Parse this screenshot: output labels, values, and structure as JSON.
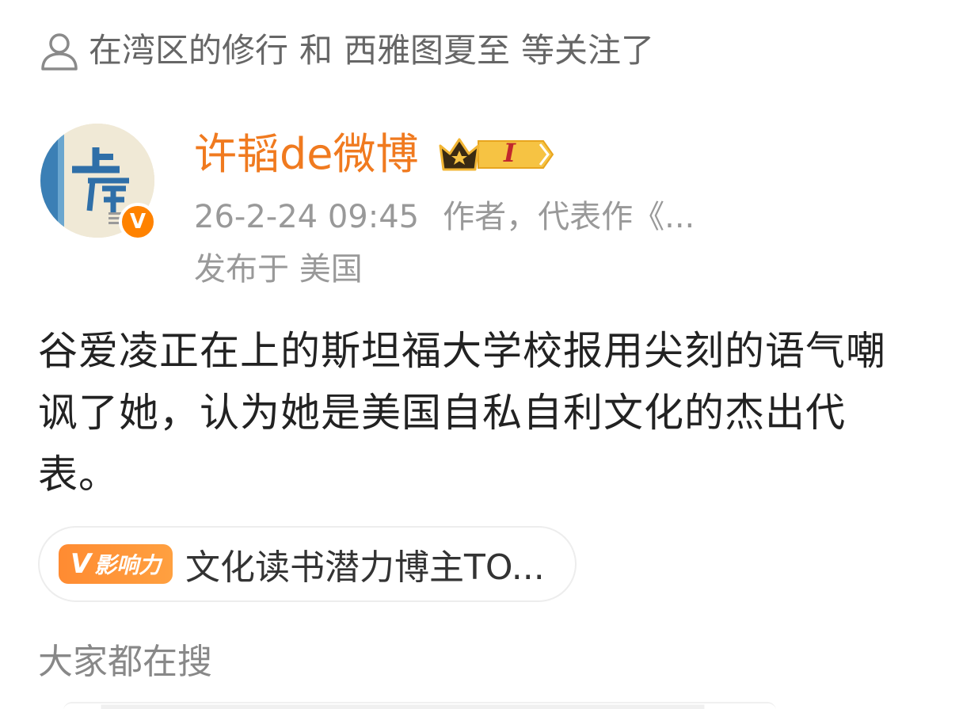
{
  "follow": {
    "icon": "person-icon",
    "text_parts": [
      "在湾区的修行",
      "和",
      "西雅图夏至",
      "等关注了"
    ]
  },
  "author": {
    "avatar_text_top": "上",
    "avatar_text_bottom": "岸",
    "verified_mark": "V",
    "name": "许韬de微博",
    "badge_icon": "crown-badge-icon",
    "badge_level": "I",
    "time": "26-2-24 09:45",
    "description": "作者，代表作《...",
    "location": "发布于 美国"
  },
  "post": {
    "text": "谷爱凌正在上的斯坦福大学校报用尖刻的语气嘲讽了她，认为她是美国自私自利文化的杰出代表。"
  },
  "influence": {
    "tag_mark": "V",
    "tag_label": "影响力",
    "text": "文化读书潜力博主TO..."
  },
  "search": {
    "heading": "大家都在搜"
  },
  "colors": {
    "accent": "#f07a1f",
    "meta_gray": "#999999",
    "body_text": "#222222"
  }
}
